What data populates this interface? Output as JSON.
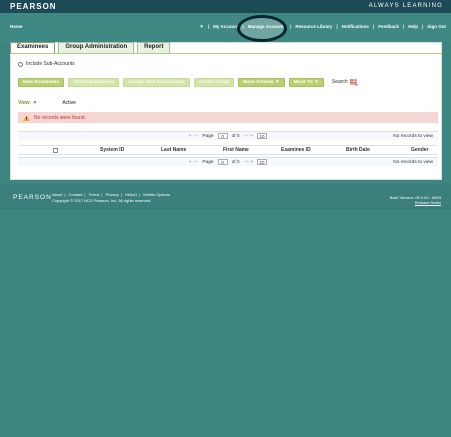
{
  "brand": "PEARSON",
  "tagline": "ALWAYS LEARNING",
  "nav": {
    "home": "Home",
    "dropdown_glyph": "▼",
    "links": [
      {
        "label": "My Account"
      },
      {
        "label": "Manage Accounts"
      },
      {
        "label": "Resource Library"
      },
      {
        "label": "Notifications"
      },
      {
        "label": "Feedback"
      },
      {
        "label": "Help"
      },
      {
        "label": "Sign Out"
      }
    ]
  },
  "tabs": [
    {
      "label": "Examinees",
      "active": true
    },
    {
      "label": "Group Administration",
      "active": false
    },
    {
      "label": "Report",
      "active": false
    }
  ],
  "subaccounts_label": "Include Sub-Accounts",
  "toolbar": {
    "new_examinees": "New Examinees",
    "delete_examinees": "Delete Examinees",
    "assign_new_assessment": "Assign New Assessment",
    "create_group": "Create Group",
    "more_actions": "More Actions",
    "move_to": "Move To",
    "search": "Search"
  },
  "view": {
    "label": "View:",
    "value": "Active"
  },
  "alert": "No records were found.",
  "pager": {
    "page_label": "Page",
    "page_value": "0",
    "of_label": "of 0",
    "page_size": "10",
    "records": "No records to view",
    "first_prev": "⇤ ⇠",
    "next_last": "⇢ ⇥"
  },
  "grid": {
    "columns": [
      "System ID",
      "Last Name",
      "First Name",
      "Examinee ID",
      "Birth Date",
      "Gender"
    ]
  },
  "footer": {
    "logo": "PEARSON",
    "links": [
      "About",
      "Contact",
      "Terms",
      "Privacy",
      "HelloO",
      "Mobile Options"
    ],
    "copyright": "Copyright © 2017 NCS Pearson, Inc. All rights reserved.",
    "build": "Build Version: 06.0.00 - 6693",
    "release_notes": "Release Notes"
  },
  "colors": {
    "background": "#3c8580",
    "header": "#1c4a56",
    "accent": "#b8d070",
    "alert": "#f6d5d5"
  }
}
